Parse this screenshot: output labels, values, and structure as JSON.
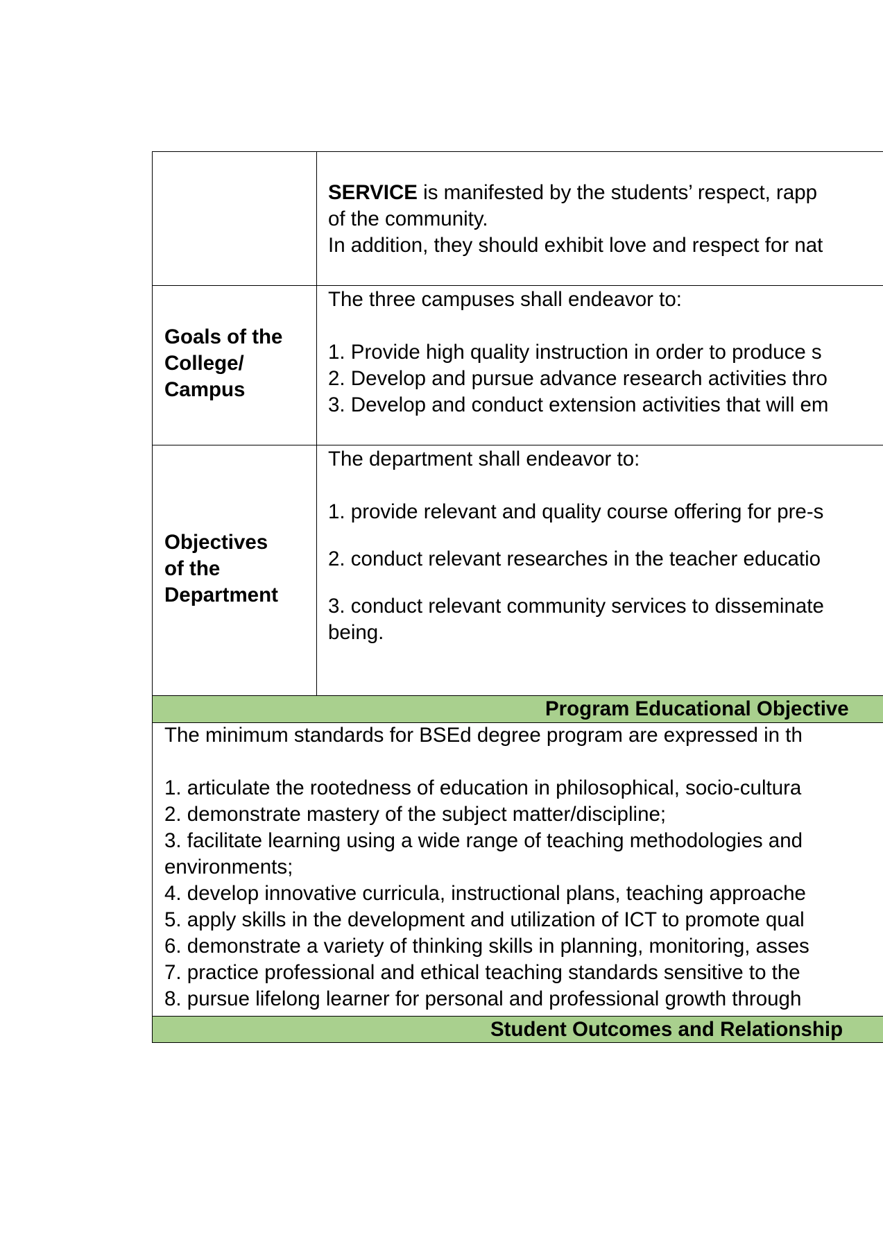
{
  "service": {
    "bold": "SERVICE",
    "line1": " is manifested by the students’ respect, rapp",
    "line2": "of the community.",
    "line3": "In addition, they should exhibit love and respect for nat"
  },
  "goals": {
    "label": [
      "Goals of the",
      "College/",
      "Campus"
    ],
    "intro": "The three campuses shall endeavor to:",
    "items": [
      "1. Provide high quality instruction in order to produce s",
      "2. Develop and pursue advance research activities thro",
      "3. Develop and conduct extension activities that will em"
    ]
  },
  "objectives": {
    "label": [
      "Objectives",
      "of the",
      "Department"
    ],
    "intro": "The department shall endeavor to:",
    "item1": "1.  provide relevant and quality course offering for pre-s",
    "item2": "2. conduct relevant researches in the teacher educatio",
    "item3_line1": "3.  conduct relevant community services to disseminate",
    "item3_line2": "being."
  },
  "peo": {
    "heading": "Program Educational Objective",
    "intro": "The minimum standards for BSEd degree program are expressed in th",
    "items": [
      "1. articulate the rootedness of education in philosophical, socio-cultura",
      "2. demonstrate mastery of the subject matter/discipline;",
      "3. facilitate learning using a wide range of teaching methodologies and",
      "environments;",
      "4. develop innovative curricula, instructional plans, teaching approache",
      "5. apply skills in the development and utilization of ICT to promote qual",
      "6. demonstrate a variety of thinking skills in planning, monitoring, asses",
      "7. practice professional and ethical teaching standards sensitive to the",
      "8. pursue lifelong learner for personal and professional growth through"
    ]
  },
  "student_outcomes": {
    "heading": "Student Outcomes and Relationship"
  }
}
